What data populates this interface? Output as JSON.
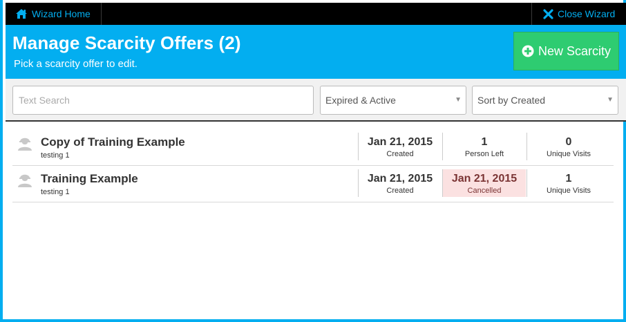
{
  "nav": {
    "home_label": "Wizard Home",
    "home_icon": "home-icon",
    "close_label": "Close Wizard",
    "close_icon": "close-icon",
    "accent": "#03aef0"
  },
  "header": {
    "title": "Manage Scarcity Offers (2)",
    "subtitle": "Pick a scarcity offer to edit.",
    "new_button_label": "New Scarcity",
    "new_button_icon": "plus-circle-icon",
    "background": "#03aef0",
    "button_color": "#2ecc71"
  },
  "filters": {
    "search_placeholder": "Text Search",
    "search_value": "",
    "status_selected": "Expired & Active",
    "sort_selected": "Sort by Created"
  },
  "offers": [
    {
      "name": "Copy of Training Example",
      "sub": "testing 1",
      "icon": "user-icon",
      "created_value": "Jan 21, 2015",
      "created_label": "Created",
      "status_value": "1",
      "status_label": "Person Left",
      "visits_value": "0",
      "visits_label": "Unique Visits"
    },
    {
      "name": "Training Example",
      "sub": "testing 1",
      "icon": "user-icon",
      "created_value": "Jan 21, 2015",
      "created_label": "Created",
      "status_value": "Jan 21, 2015",
      "status_label": "Cancelled",
      "status_color": "#fbe1e1",
      "visits_value": "1",
      "visits_label": "Unique Visits"
    }
  ]
}
